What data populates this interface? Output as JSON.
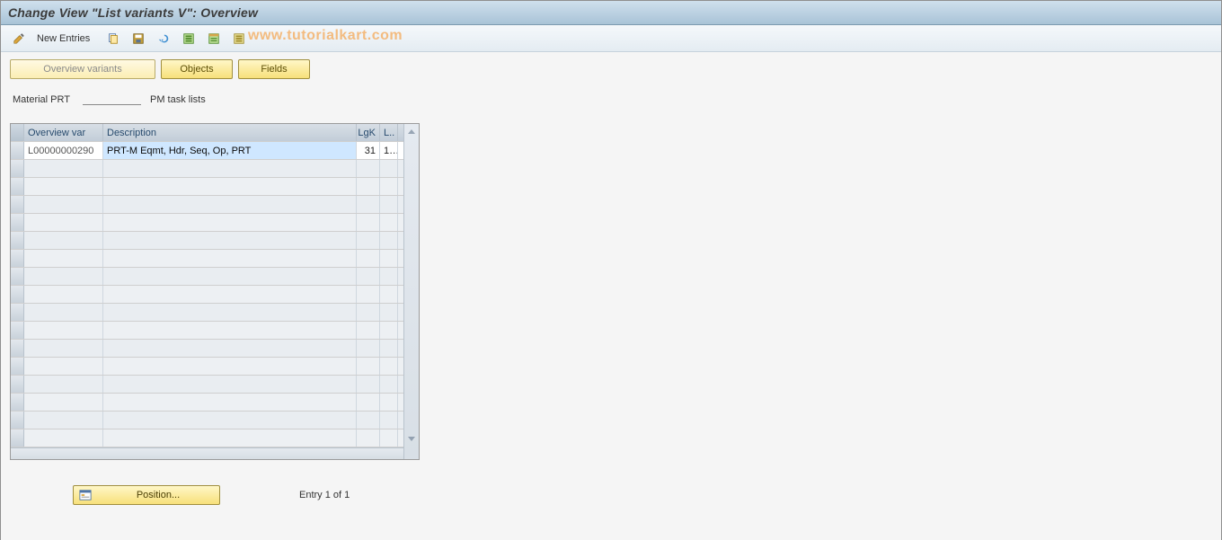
{
  "title": "Change View \"List variants                    V\": Overview",
  "toolbar": {
    "new_entries_label": "New Entries"
  },
  "watermark": "www.tutorialkart.com",
  "tabs": {
    "overview_variants": "Overview variants",
    "objects": "Objects",
    "fields": "Fields"
  },
  "info": {
    "material_prt": "Material PRT",
    "task_lists": "PM task lists"
  },
  "table": {
    "headers": {
      "overview_var": "Overview var",
      "description": "Description",
      "lgk": "LgK",
      "l": "L.."
    },
    "rows": [
      {
        "var": "L00000000290",
        "desc": "PRT-M Eqmt, Hdr, Seq, Op, PRT",
        "lgk": "31",
        "l": "1…"
      }
    ],
    "empty_rows": 16
  },
  "footer": {
    "position_label": "Position...",
    "entry_text": "Entry 1 of 1"
  },
  "icons": {
    "pencil": "pencil-icon",
    "copy": "copy-icon",
    "save": "save-icon",
    "undo": "undo-icon",
    "table_settings": "table-settings-icon",
    "select_all": "select-all-icon",
    "deselect_all": "deselect-all-icon",
    "position": "position-icon",
    "scroll_up": "scroll-up-icon",
    "scroll_down": "scroll-down-icon"
  }
}
